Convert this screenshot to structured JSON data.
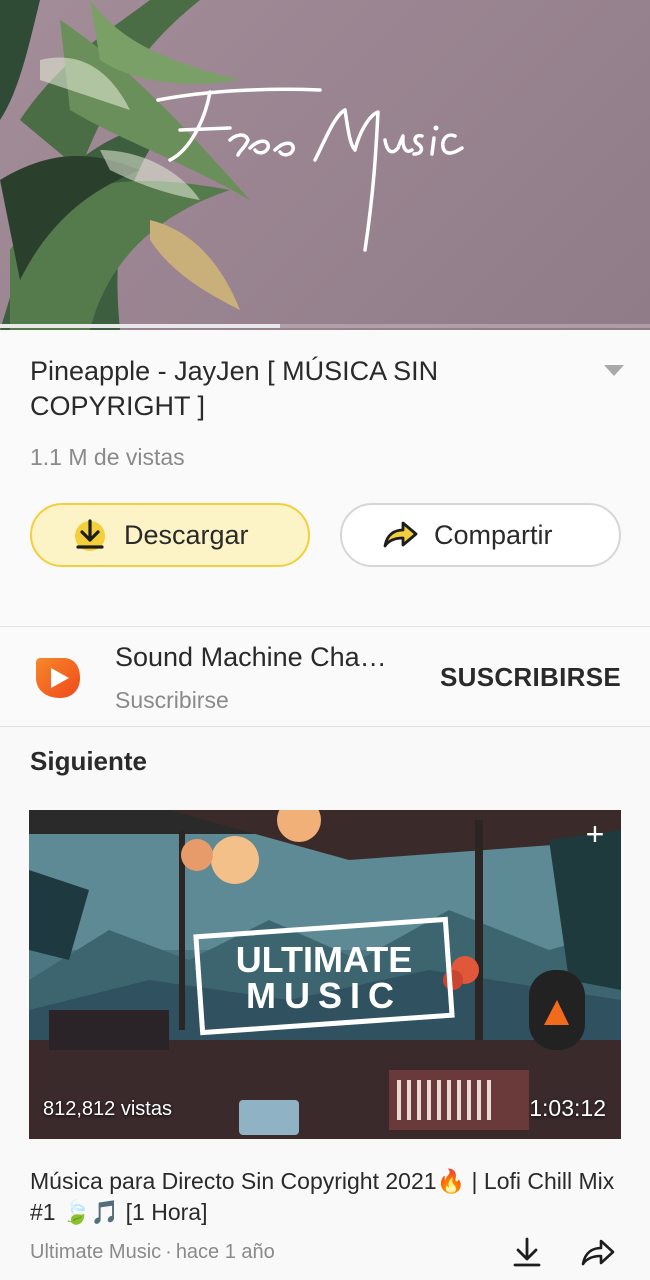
{
  "player": {
    "overlay_text": "Free Music",
    "progress": 0.43
  },
  "video": {
    "title": "Pineapple - JayJen [ MÚSICA SIN COPYRIGHT ]",
    "views": "1.1 M de vistas",
    "download_label": "Descargar",
    "share_label": "Compartir"
  },
  "channel": {
    "name": "Sound Machine Cha…",
    "subtitle": "Suscribirse",
    "subscribe_label": "SUSCRIBIRSE"
  },
  "up_next": {
    "heading": "Siguiente",
    "item": {
      "thumb_text_line1": "ULTIMATE",
      "thumb_text_line2": "MUSIC",
      "views": "812,812 vistas",
      "duration": "1:03:12",
      "title": "Música para Directo Sin Copyright 2021🔥 | Lofi Chill Mix #1 🍃🎵 [1 Hora]",
      "channel": "Ultimate Music",
      "separator": "·",
      "age": "hace 1 año"
    }
  },
  "colors": {
    "accent_yellow": "#f2cf3b",
    "download_bg": "#fcf3c6",
    "channel_icon": "#f26a1b"
  }
}
